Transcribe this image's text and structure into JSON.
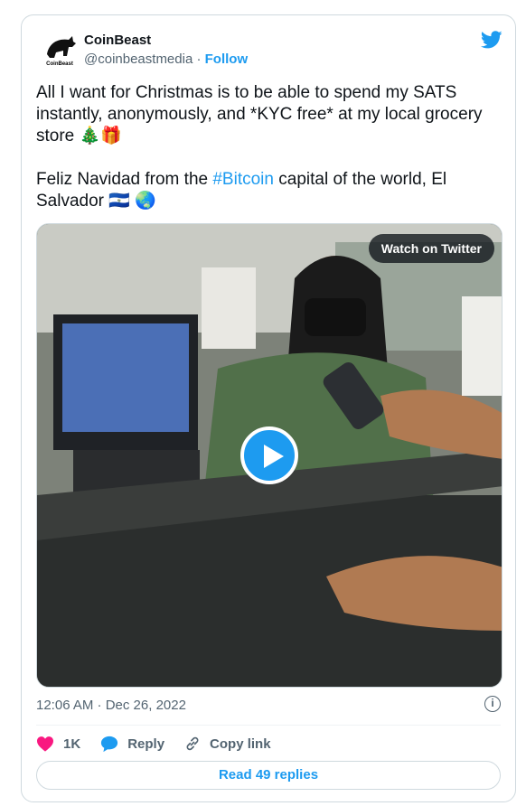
{
  "author": {
    "name": "CoinBeast",
    "handle": "@coinbeastmedia",
    "follow": "Follow",
    "avatar_text": "CoinBeast"
  },
  "tweet": {
    "text_before_hashtag": "All I want for Christmas is to be able to spend my SATS instantly, anonymously, and *KYC free* at my local grocery store 🎄🎁\n\nFeliz Navidad from the ",
    "hashtag": "#Bitcoin",
    "text_after_hashtag": " capital of the world, El Salvador 🇸🇻 🌏"
  },
  "media": {
    "watch_label": "Watch on Twitter"
  },
  "timestamp": "12:06 AM · Dec 26, 2022",
  "actions": {
    "likes": "1K",
    "reply": "Reply",
    "copy": "Copy link"
  },
  "read_replies": "Read 49 replies",
  "colors": {
    "accent": "#1d9bf0",
    "like": "#f91880"
  }
}
